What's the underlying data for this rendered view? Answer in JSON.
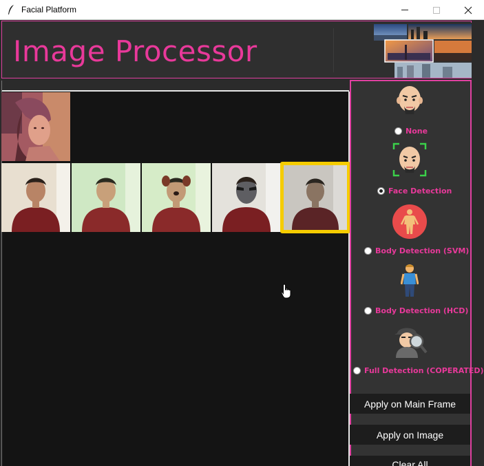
{
  "window": {
    "title": "Facial Platform"
  },
  "header": {
    "title": "Image Processor"
  },
  "options": [
    {
      "label": "None",
      "icon": "bald-man-face-icon",
      "checked": false
    },
    {
      "label": "Face Detection",
      "icon": "face-detection-icon",
      "checked": true
    },
    {
      "label": "Body Detection (SVM)",
      "icon": "body-anatomy-icon",
      "checked": false
    },
    {
      "label": "Body Detection (HCD)",
      "icon": "standing-person-icon",
      "checked": false
    },
    {
      "label": "Full Detection (COPERATED)",
      "icon": "detective-icon",
      "checked": false
    }
  ],
  "buttons": {
    "apply_main": "Apply on Main Frame",
    "apply_image": "Apply on Image",
    "clear_all": "Clear All"
  },
  "colors": {
    "accent": "#e8399a",
    "selection": "#f5cc00",
    "panel": "#333333"
  }
}
